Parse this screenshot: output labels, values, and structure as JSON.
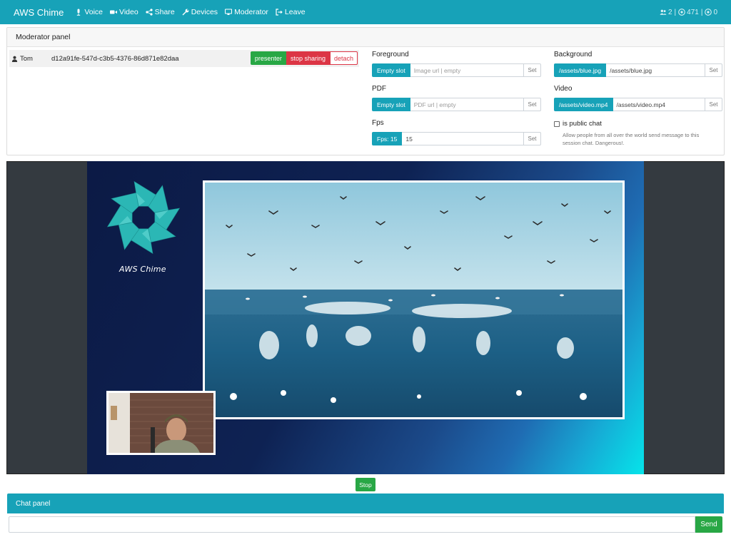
{
  "navbar": {
    "brand": "AWS Chime",
    "items": [
      {
        "label": "Voice",
        "icon": "microphone-icon"
      },
      {
        "label": "Video",
        "icon": "video-camera-icon"
      },
      {
        "label": "Share",
        "icon": "share-icon"
      },
      {
        "label": "Devices",
        "icon": "wrench-icon"
      },
      {
        "label": "Moderator",
        "icon": "monitor-icon"
      },
      {
        "label": "Leave",
        "icon": "sign-out-icon"
      }
    ],
    "stats": {
      "users": "2",
      "sep1": "|",
      "views": "471",
      "sep2": "|",
      "other": "0"
    }
  },
  "moderator": {
    "title": "Moderator panel",
    "user": {
      "name": "Tom",
      "id": "d12a91fe-547d-c3b5-4376-86d871e82daa",
      "buttons": {
        "presenter": "presenter",
        "stop_sharing": "stop sharing",
        "detach": "detach"
      }
    },
    "foreground": {
      "label": "Foreground",
      "prefix": "Empty slot",
      "placeholder": "Image url | empty",
      "set": "Set"
    },
    "background": {
      "label": "Background",
      "prefix": "/assets/blue.jpg",
      "value": "/assets/blue.jpg",
      "set": "Set"
    },
    "pdf": {
      "label": "PDF",
      "prefix": "Empty slot",
      "placeholder": "PDF url | empty",
      "set": "Set"
    },
    "video": {
      "label": "Video",
      "prefix": "/assets/video.mp4",
      "value": "/assets/video.mp4",
      "set": "Set"
    },
    "fps": {
      "label": "Fps",
      "prefix": "Fps: 15",
      "value": "15",
      "set": "Set"
    },
    "public_chat": {
      "label": "is public chat",
      "checked": false,
      "help": "Allow people from all over the world send message to this session chat. Dangerous!."
    }
  },
  "stage": {
    "logo_text": "AWS Chime",
    "stop": "Stop"
  },
  "chat": {
    "title": "Chat panel",
    "input_value": "",
    "send": "Send"
  },
  "colors": {
    "primary": "#17a2b8",
    "success": "#28a745",
    "danger": "#dc3545",
    "stage_bg": "#343a40",
    "logo_teal": "#2bb7b5"
  }
}
